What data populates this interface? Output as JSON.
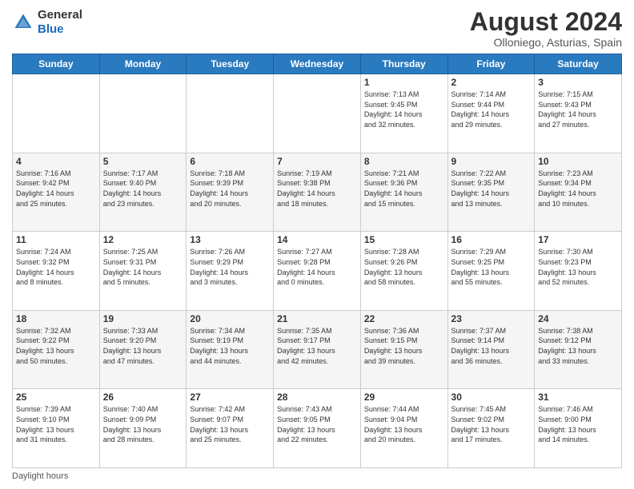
{
  "logo": {
    "general": "General",
    "blue": "Blue"
  },
  "header": {
    "month": "August 2024",
    "location": "Olloniego, Asturias, Spain"
  },
  "weekdays": [
    "Sunday",
    "Monday",
    "Tuesday",
    "Wednesday",
    "Thursday",
    "Friday",
    "Saturday"
  ],
  "footer": {
    "daylight": "Daylight hours"
  },
  "weeks": [
    [
      {
        "day": "",
        "info": ""
      },
      {
        "day": "",
        "info": ""
      },
      {
        "day": "",
        "info": ""
      },
      {
        "day": "",
        "info": ""
      },
      {
        "day": "1",
        "info": "Sunrise: 7:13 AM\nSunset: 9:45 PM\nDaylight: 14 hours\nand 32 minutes."
      },
      {
        "day": "2",
        "info": "Sunrise: 7:14 AM\nSunset: 9:44 PM\nDaylight: 14 hours\nand 29 minutes."
      },
      {
        "day": "3",
        "info": "Sunrise: 7:15 AM\nSunset: 9:43 PM\nDaylight: 14 hours\nand 27 minutes."
      }
    ],
    [
      {
        "day": "4",
        "info": "Sunrise: 7:16 AM\nSunset: 9:42 PM\nDaylight: 14 hours\nand 25 minutes."
      },
      {
        "day": "5",
        "info": "Sunrise: 7:17 AM\nSunset: 9:40 PM\nDaylight: 14 hours\nand 23 minutes."
      },
      {
        "day": "6",
        "info": "Sunrise: 7:18 AM\nSunset: 9:39 PM\nDaylight: 14 hours\nand 20 minutes."
      },
      {
        "day": "7",
        "info": "Sunrise: 7:19 AM\nSunset: 9:38 PM\nDaylight: 14 hours\nand 18 minutes."
      },
      {
        "day": "8",
        "info": "Sunrise: 7:21 AM\nSunset: 9:36 PM\nDaylight: 14 hours\nand 15 minutes."
      },
      {
        "day": "9",
        "info": "Sunrise: 7:22 AM\nSunset: 9:35 PM\nDaylight: 14 hours\nand 13 minutes."
      },
      {
        "day": "10",
        "info": "Sunrise: 7:23 AM\nSunset: 9:34 PM\nDaylight: 14 hours\nand 10 minutes."
      }
    ],
    [
      {
        "day": "11",
        "info": "Sunrise: 7:24 AM\nSunset: 9:32 PM\nDaylight: 14 hours\nand 8 minutes."
      },
      {
        "day": "12",
        "info": "Sunrise: 7:25 AM\nSunset: 9:31 PM\nDaylight: 14 hours\nand 5 minutes."
      },
      {
        "day": "13",
        "info": "Sunrise: 7:26 AM\nSunset: 9:29 PM\nDaylight: 14 hours\nand 3 minutes."
      },
      {
        "day": "14",
        "info": "Sunrise: 7:27 AM\nSunset: 9:28 PM\nDaylight: 14 hours\nand 0 minutes."
      },
      {
        "day": "15",
        "info": "Sunrise: 7:28 AM\nSunset: 9:26 PM\nDaylight: 13 hours\nand 58 minutes."
      },
      {
        "day": "16",
        "info": "Sunrise: 7:29 AM\nSunset: 9:25 PM\nDaylight: 13 hours\nand 55 minutes."
      },
      {
        "day": "17",
        "info": "Sunrise: 7:30 AM\nSunset: 9:23 PM\nDaylight: 13 hours\nand 52 minutes."
      }
    ],
    [
      {
        "day": "18",
        "info": "Sunrise: 7:32 AM\nSunset: 9:22 PM\nDaylight: 13 hours\nand 50 minutes."
      },
      {
        "day": "19",
        "info": "Sunrise: 7:33 AM\nSunset: 9:20 PM\nDaylight: 13 hours\nand 47 minutes."
      },
      {
        "day": "20",
        "info": "Sunrise: 7:34 AM\nSunset: 9:19 PM\nDaylight: 13 hours\nand 44 minutes."
      },
      {
        "day": "21",
        "info": "Sunrise: 7:35 AM\nSunset: 9:17 PM\nDaylight: 13 hours\nand 42 minutes."
      },
      {
        "day": "22",
        "info": "Sunrise: 7:36 AM\nSunset: 9:15 PM\nDaylight: 13 hours\nand 39 minutes."
      },
      {
        "day": "23",
        "info": "Sunrise: 7:37 AM\nSunset: 9:14 PM\nDaylight: 13 hours\nand 36 minutes."
      },
      {
        "day": "24",
        "info": "Sunrise: 7:38 AM\nSunset: 9:12 PM\nDaylight: 13 hours\nand 33 minutes."
      }
    ],
    [
      {
        "day": "25",
        "info": "Sunrise: 7:39 AM\nSunset: 9:10 PM\nDaylight: 13 hours\nand 31 minutes."
      },
      {
        "day": "26",
        "info": "Sunrise: 7:40 AM\nSunset: 9:09 PM\nDaylight: 13 hours\nand 28 minutes."
      },
      {
        "day": "27",
        "info": "Sunrise: 7:42 AM\nSunset: 9:07 PM\nDaylight: 13 hours\nand 25 minutes."
      },
      {
        "day": "28",
        "info": "Sunrise: 7:43 AM\nSunset: 9:05 PM\nDaylight: 13 hours\nand 22 minutes."
      },
      {
        "day": "29",
        "info": "Sunrise: 7:44 AM\nSunset: 9:04 PM\nDaylight: 13 hours\nand 20 minutes."
      },
      {
        "day": "30",
        "info": "Sunrise: 7:45 AM\nSunset: 9:02 PM\nDaylight: 13 hours\nand 17 minutes."
      },
      {
        "day": "31",
        "info": "Sunrise: 7:46 AM\nSunset: 9:00 PM\nDaylight: 13 hours\nand 14 minutes."
      }
    ]
  ]
}
